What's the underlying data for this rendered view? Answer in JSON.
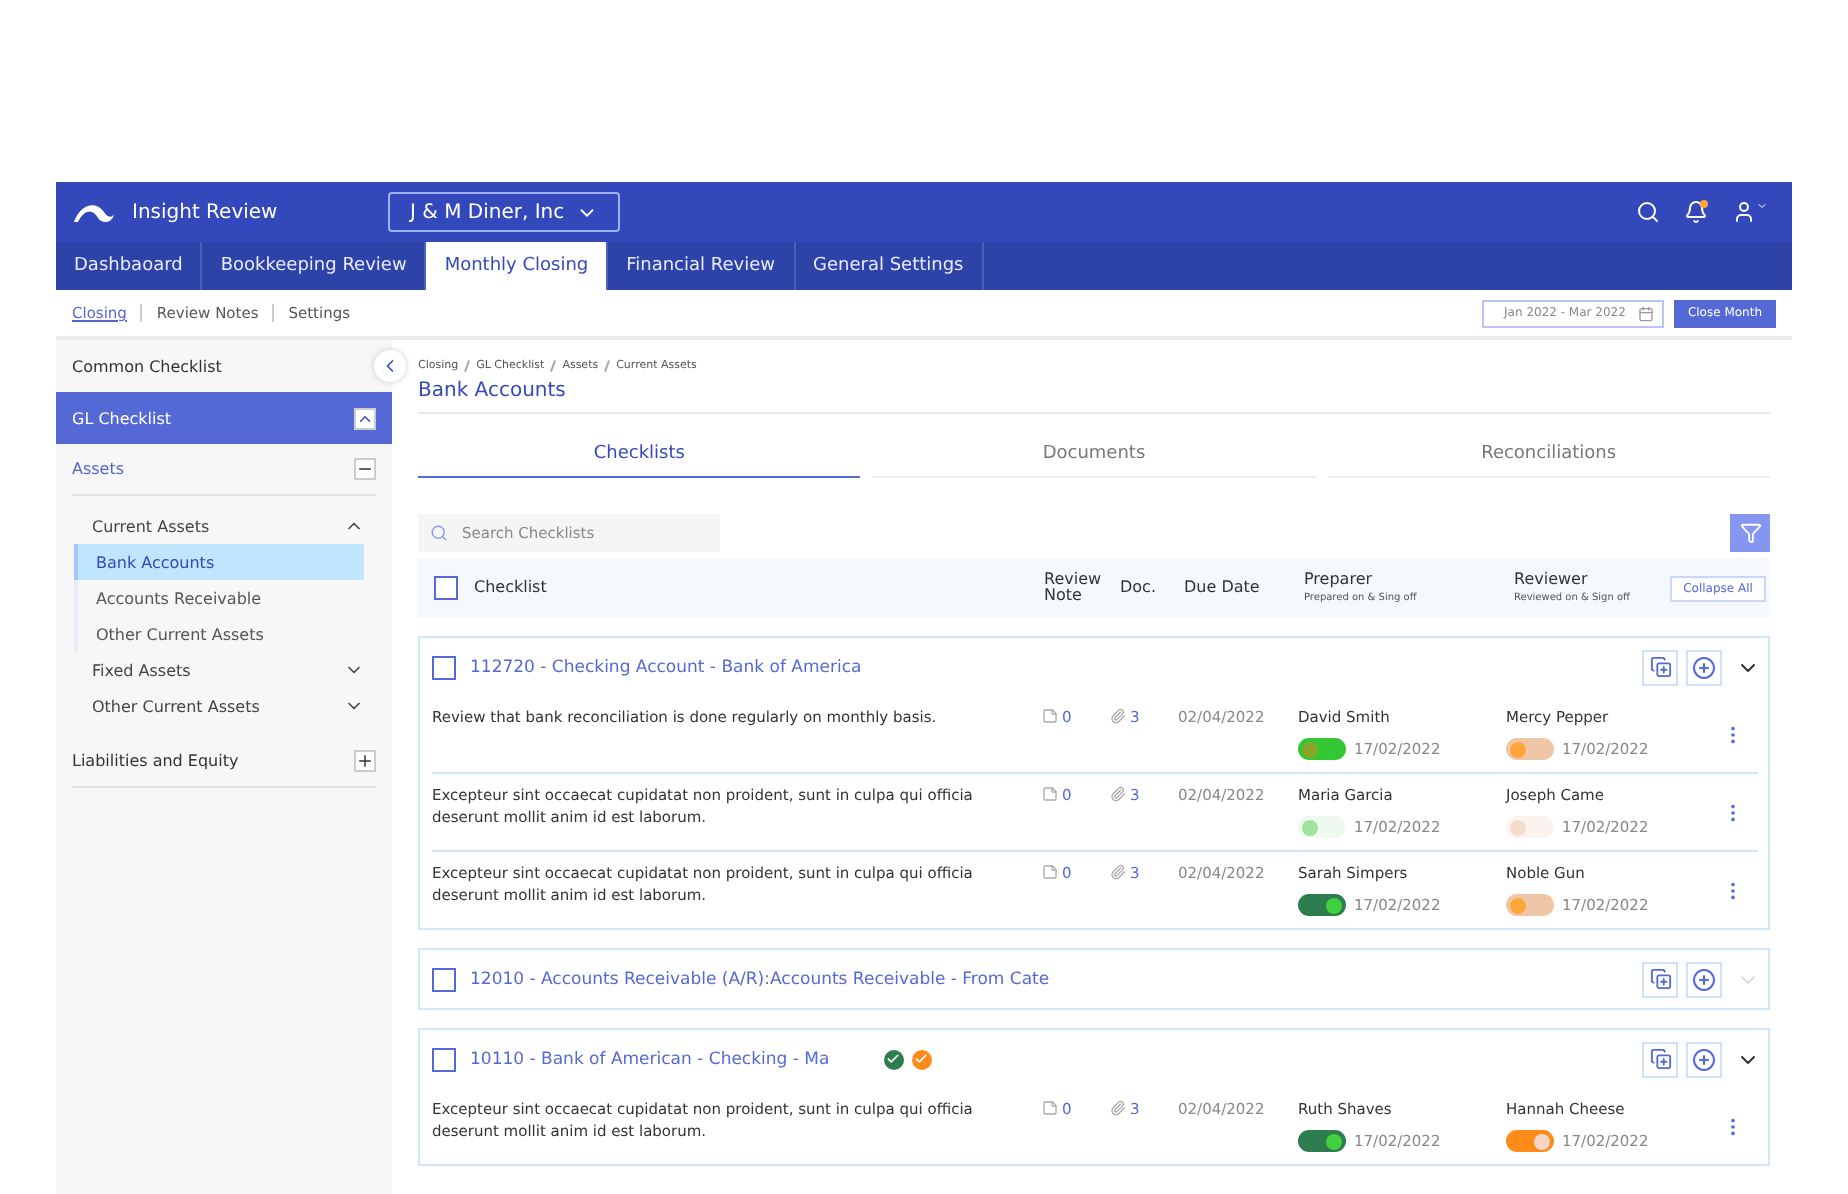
{
  "app": {
    "name": "Insight Review",
    "company": "J & M Diner, Inc",
    "notification": true
  },
  "nav_tabs": [
    {
      "label": "Dashbaoard",
      "selected": false
    },
    {
      "label": "Bookkeeping Review",
      "selected": false
    },
    {
      "label": "Monthly Closing",
      "selected": true
    },
    {
      "label": "Financial Review",
      "selected": false
    },
    {
      "label": "General Settings",
      "selected": false
    }
  ],
  "sub_tabs": [
    {
      "label": "Closing",
      "selected": true
    },
    {
      "label": "Review Notes",
      "selected": false
    },
    {
      "label": "Settings",
      "selected": false
    }
  ],
  "date_range": "Jan 2022 - Mar 2022",
  "close_button": "Close Month",
  "sidebar": {
    "items": [
      {
        "label": "Common Checklist",
        "kind": "plain"
      },
      {
        "label": "GL Checklist",
        "kind": "section",
        "expanded": true,
        "children": [
          {
            "label": "Assets",
            "kind": "group",
            "expanded": true,
            "children": [
              {
                "label": "Current Assets",
                "kind": "sub",
                "expanded": true,
                "children": [
                  {
                    "label": "Bank Accounts",
                    "kind": "leaf",
                    "selected": true
                  },
                  {
                    "label": "Accounts Receivable",
                    "kind": "leaf",
                    "selected": false
                  },
                  {
                    "label": "Other Current Assets",
                    "kind": "leaf",
                    "selected": false
                  }
                ]
              },
              {
                "label": "Fixed Assets",
                "kind": "sub",
                "expanded": false
              },
              {
                "label": "Other Current Assets",
                "kind": "sub",
                "expanded": false
              }
            ]
          },
          {
            "label": "Liabilities and Equity",
            "kind": "group",
            "expanded": false
          }
        ]
      }
    ]
  },
  "breadcrumb": [
    "Closing",
    "GL Checklist",
    "Assets",
    "Current Assets"
  ],
  "page_title": "Bank Accounts",
  "content_tabs": [
    {
      "label": "Checklists",
      "selected": true
    },
    {
      "label": "Documents",
      "selected": false
    },
    {
      "label": "Reconciliations",
      "selected": false
    }
  ],
  "search": {
    "placeholder": "Search Checklists"
  },
  "table": {
    "columns": [
      {
        "label": "Checklist"
      },
      {
        "label": "Review Note"
      },
      {
        "label": "Doc."
      },
      {
        "label": "Due Date"
      },
      {
        "label": "Preparer",
        "sub": "Prepared on & Sing off"
      },
      {
        "label": "Reviewer",
        "sub": "Reviewed on & Sign off"
      }
    ],
    "select_all_checked": false,
    "collapse_button": "Collapse All",
    "groups": [
      {
        "title": "112720 - Checking Account - Bank of America",
        "checked": false,
        "expanded": true,
        "items": [
          {
            "text": "Review that bank reconciliation is done regularly on monthly basis.",
            "notes": "0",
            "docs": "3",
            "due": "02/04/2022",
            "preparer": {
              "name": "David Smith",
              "date": "17/02/2022",
              "on": false,
              "color": "#34c734",
              "thumb": {
                "color": "#8aa62a"
              }
            },
            "reviewer": {
              "name": "Mercy Pepper",
              "date": "17/02/2022",
              "on": false,
              "color": "#efc6a6",
              "thumb": {
                "color": "#ffa53a"
              }
            }
          },
          {
            "text": "Excepteur sint occaecat cupidatat non proident, sunt in culpa qui officia deserunt mollit anim id est laborum.",
            "notes": "0",
            "docs": "3",
            "due": "02/04/2022",
            "preparer": {
              "name": "Maria Garcia",
              "date": "17/02/2022",
              "on": false,
              "color": "#eefaee",
              "thumb": {
                "color": "#9fe39f"
              }
            },
            "reviewer": {
              "name": "Joseph Came",
              "date": "17/02/2022",
              "on": false,
              "color": "#fdf3ee",
              "thumb": {
                "color": "#f6dccd"
              }
            }
          },
          {
            "text": "Excepteur sint occaecat cupidatat non proident, sunt in culpa qui officia deserunt mollit anim id est laborum.",
            "notes": "0",
            "docs": "3",
            "due": "02/04/2022",
            "preparer": {
              "name": "Sarah Simpers",
              "date": "17/02/2022",
              "on": true,
              "color": "#2e7d4f",
              "thumb": {
                "color": "#3fd13f"
              }
            },
            "reviewer": {
              "name": "Noble Gun",
              "date": "17/02/2022",
              "on": false,
              "color": "#efc6a6",
              "thumb": {
                "color": "#ffa53a"
              }
            }
          }
        ]
      },
      {
        "title": "12010 - Accounts Receivable (A/R):Accounts Receivable - From Cate",
        "checked": false,
        "expanded": false
      },
      {
        "title": "10110 - Bank of American - Checking - Ma",
        "checked": false,
        "expanded": true,
        "badges": [
          {
            "color": "#2e7d4f"
          },
          {
            "color": "#ff8c1a"
          }
        ],
        "items": [
          {
            "text": "Excepteur sint occaecat cupidatat non proident, sunt in culpa qui officia deserunt mollit anim id est laborum.",
            "notes": "0",
            "docs": "3",
            "due": "02/04/2022",
            "preparer": {
              "name": "Ruth Shaves",
              "date": "17/02/2022",
              "on": true,
              "color": "#2e7d4f",
              "thumb": {
                "color": "#3fd13f"
              }
            },
            "reviewer": {
              "name": "Hannah Cheese",
              "date": "17/02/2022",
              "on": true,
              "color": "#ff8c1a",
              "thumb": {
                "color": "#f3d6c6"
              }
            }
          }
        ]
      }
    ]
  }
}
